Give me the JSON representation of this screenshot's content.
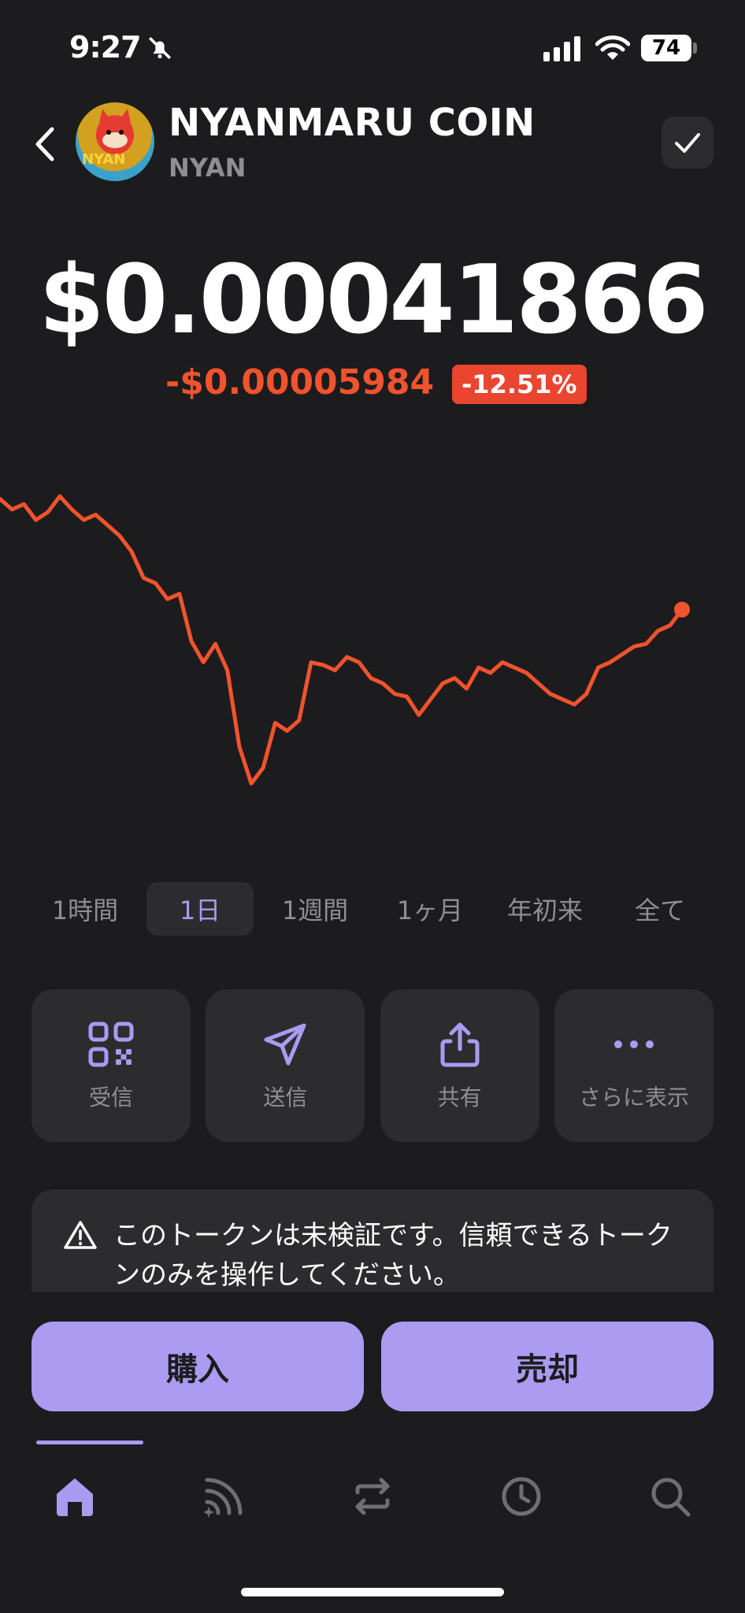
{
  "status_bar": {
    "time": "9:27",
    "battery": "74"
  },
  "header": {
    "name": "NYANMARU COIN",
    "symbol": "NYAN",
    "avatar_text": "NYAN"
  },
  "price": {
    "value": "$0.00041866",
    "change": "-$0.00005984",
    "change_pct": "-12.51%"
  },
  "chart_data": {
    "type": "line",
    "color": "#f0532e",
    "y": [
      0.00046,
      0.000456,
      0.000458,
      0.000452,
      0.000455,
      0.000461,
      0.000456,
      0.000452,
      0.000454,
      0.00045,
      0.000446,
      0.00044,
      0.00043,
      0.000428,
      0.000422,
      0.000424,
      0.000406,
      0.000398,
      0.000405,
      0.000395,
      0.000366,
      0.000352,
      0.000358,
      0.000375,
      0.000372,
      0.000376,
      0.000398,
      0.000397,
      0.000395,
      0.0004,
      0.000398,
      0.000392,
      0.00039,
      0.000386,
      0.000385,
      0.000378,
      0.000384,
      0.00039,
      0.000392,
      0.000388,
      0.000396,
      0.000394,
      0.000398,
      0.000396,
      0.000394,
      0.00039,
      0.000386,
      0.000384,
      0.000382,
      0.000386,
      0.000396,
      0.000398,
      0.000401,
      0.000404,
      0.000405,
      0.00041,
      0.000412,
      0.000418
    ]
  },
  "ranges": [
    "1時間",
    "1日",
    "1週間",
    "1ヶ月",
    "年初来",
    "全て"
  ],
  "actions": {
    "receive": "受信",
    "send": "送信",
    "share": "共有",
    "more": "さらに表示"
  },
  "warning": {
    "text": "このトークンは未検証です。信頼できるトークンのみを操作してください。"
  },
  "trade": {
    "buy": "購入",
    "sell": "売却"
  },
  "colors": {
    "accent": "#a99bf2",
    "button": "#ab9cf2",
    "negative": "#f0532e",
    "background": "#1c1c1e",
    "card": "#2c2c2e"
  }
}
